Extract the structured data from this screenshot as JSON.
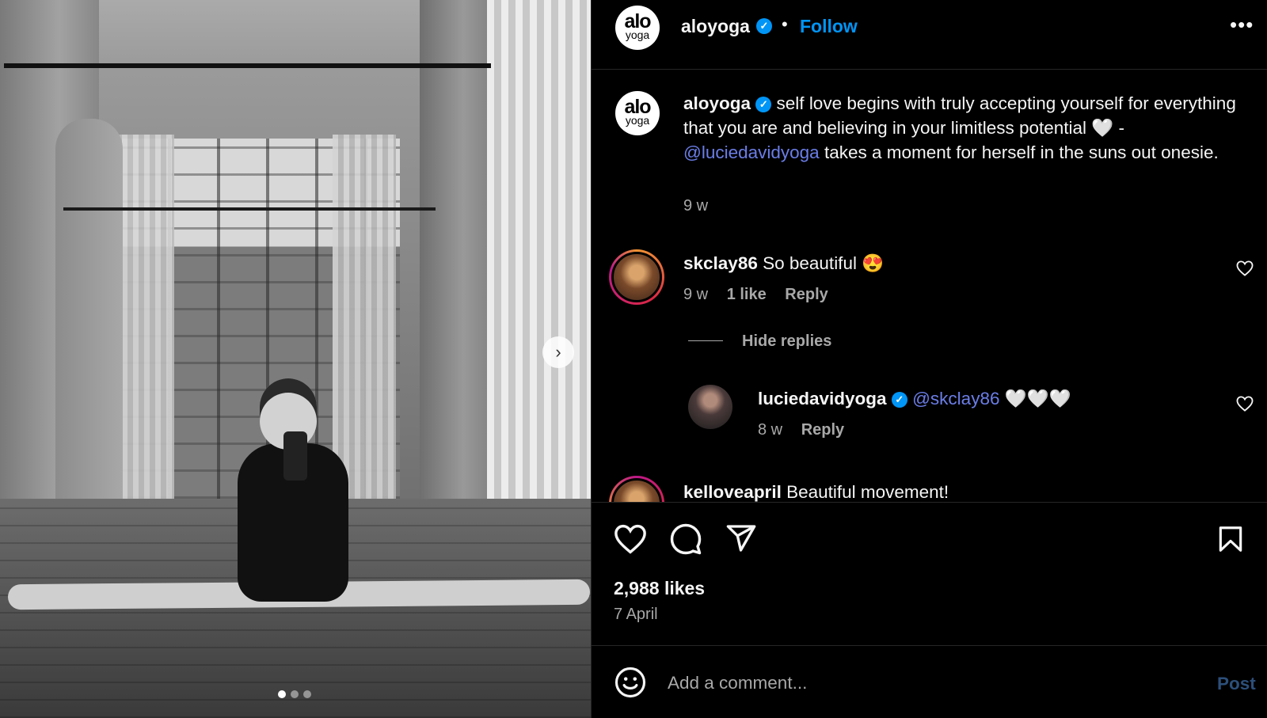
{
  "post": {
    "author": "aloyoga",
    "avatar_text_top": "alo",
    "avatar_text_bottom": "yoga",
    "separator": "•",
    "follow_label": "Follow",
    "more_label": "•••",
    "carousel": {
      "next_label": "›",
      "page_count": 3,
      "active_page": 1
    }
  },
  "caption": {
    "author": "aloyoga",
    "text_1": " self love begins with truly accepting yourself for everything that you are and believing in your limitless potential 🤍 - ",
    "mention": "@luciedavidyoga",
    "text_2": " takes a moment for herself in the suns out onesie.",
    "age": "9 w"
  },
  "comments": [
    {
      "author": "skclay86",
      "text": " So beautiful 😍",
      "age": "9 w",
      "likes": "1 like",
      "reply_label": "Reply"
    },
    {
      "author": "kelloveapril",
      "text": " Beautiful movement!"
    }
  ],
  "replies_toggle": "Hide replies",
  "reply": {
    "author": "luciedavidyoga",
    "mention": "@skclay86",
    "text": " 🤍🤍🤍",
    "age": "8 w",
    "reply_label": "Reply"
  },
  "stats": {
    "likes": "2,988 likes",
    "date": "7 April"
  },
  "composer": {
    "placeholder": "Add a comment...",
    "post_label": "Post"
  },
  "colors": {
    "accent": "#0095f6",
    "mention": "#6b7ee8",
    "muted": "#a8a8a8",
    "background": "#000000"
  },
  "icons": [
    "heart-icon",
    "comment-icon",
    "share-icon",
    "bookmark-icon",
    "emoji-icon",
    "verified-icon",
    "chevron-right-icon"
  ]
}
